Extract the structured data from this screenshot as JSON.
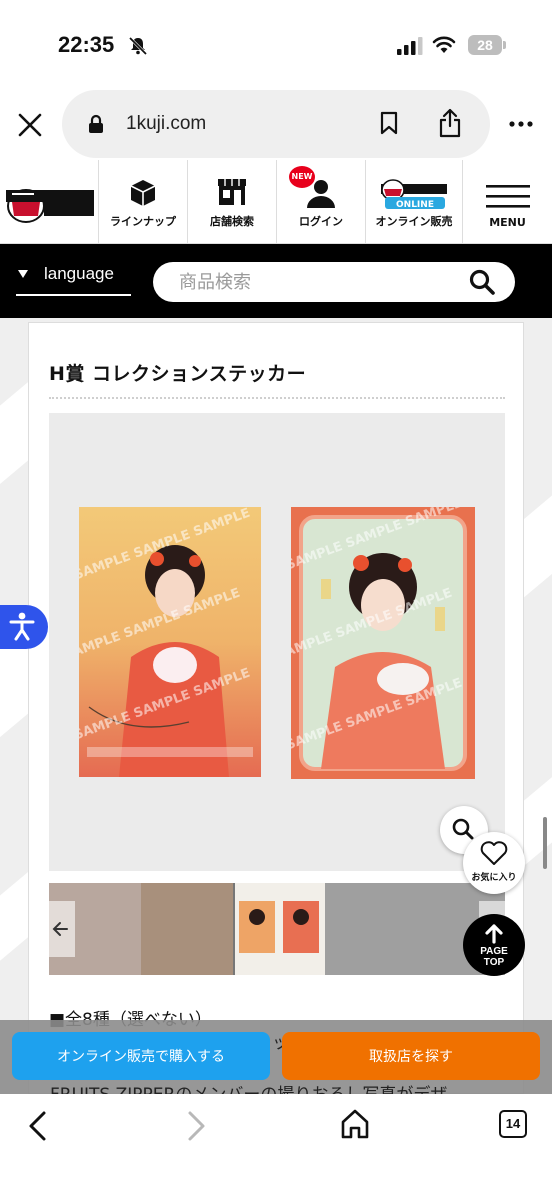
{
  "status_bar": {
    "time": "22:35",
    "battery": "28"
  },
  "browser": {
    "url": "1kuji.com"
  },
  "site_nav": {
    "logo_alt": "一番くじ倶楽部",
    "items": [
      {
        "label": "ラインナップ",
        "icon": "box-icon"
      },
      {
        "label": "店舗検索",
        "icon": "store-icon"
      },
      {
        "label": "ログイン",
        "icon": "user-icon",
        "badge": "NEW"
      },
      {
        "label": "オンライン販売",
        "icon": "ichiban-online-logo"
      },
      {
        "label": "MENU",
        "icon": "hamburger-icon"
      }
    ]
  },
  "search": {
    "language_label": "language",
    "placeholder": "商品検索"
  },
  "product": {
    "title": "H賞 コレクションステッカー",
    "description_heading": "■全8種（選べない）"
  },
  "floating": {
    "favorite_label": "お気に入り",
    "page_top_line1": "PAGE",
    "page_top_line2": "TOP"
  },
  "cta": {
    "online_label": "オンライン販売で購入する",
    "store_label": "取扱店を探す",
    "behind_text_1": "ッ",
    "behind_text_2": "FRUITS ZIPPERのメンバーの撮りおろし写真がデザ"
  },
  "toolbar": {
    "tab_count": "14"
  },
  "colors": {
    "online_button": "#1ea1ee",
    "store_button": "#f07100",
    "accessibility": "#2f54eb"
  }
}
